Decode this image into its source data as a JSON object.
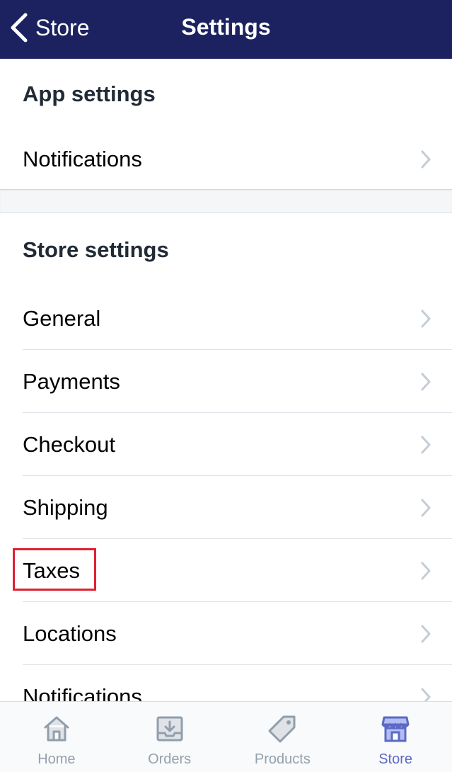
{
  "navbar": {
    "back_label": "Store",
    "title": "Settings",
    "background": "#1c2260"
  },
  "app_settings": {
    "header": "App settings",
    "items": [
      {
        "label": "Notifications"
      }
    ]
  },
  "store_settings": {
    "header": "Store settings",
    "items": [
      {
        "label": "General"
      },
      {
        "label": "Payments"
      },
      {
        "label": "Checkout"
      },
      {
        "label": "Shipping"
      },
      {
        "label": "Taxes",
        "highlighted": true
      },
      {
        "label": "Locations"
      },
      {
        "label": "Notifications"
      }
    ]
  },
  "tabbar": {
    "tabs": [
      {
        "label": "Home",
        "icon": "home-icon"
      },
      {
        "label": "Orders",
        "icon": "orders-icon"
      },
      {
        "label": "Products",
        "icon": "tag-icon"
      },
      {
        "label": "Store",
        "icon": "store-icon",
        "active": true
      }
    ],
    "active_color": "#5c6ac4",
    "inactive_color": "#95a0ad"
  },
  "highlight_color": "#e02030"
}
